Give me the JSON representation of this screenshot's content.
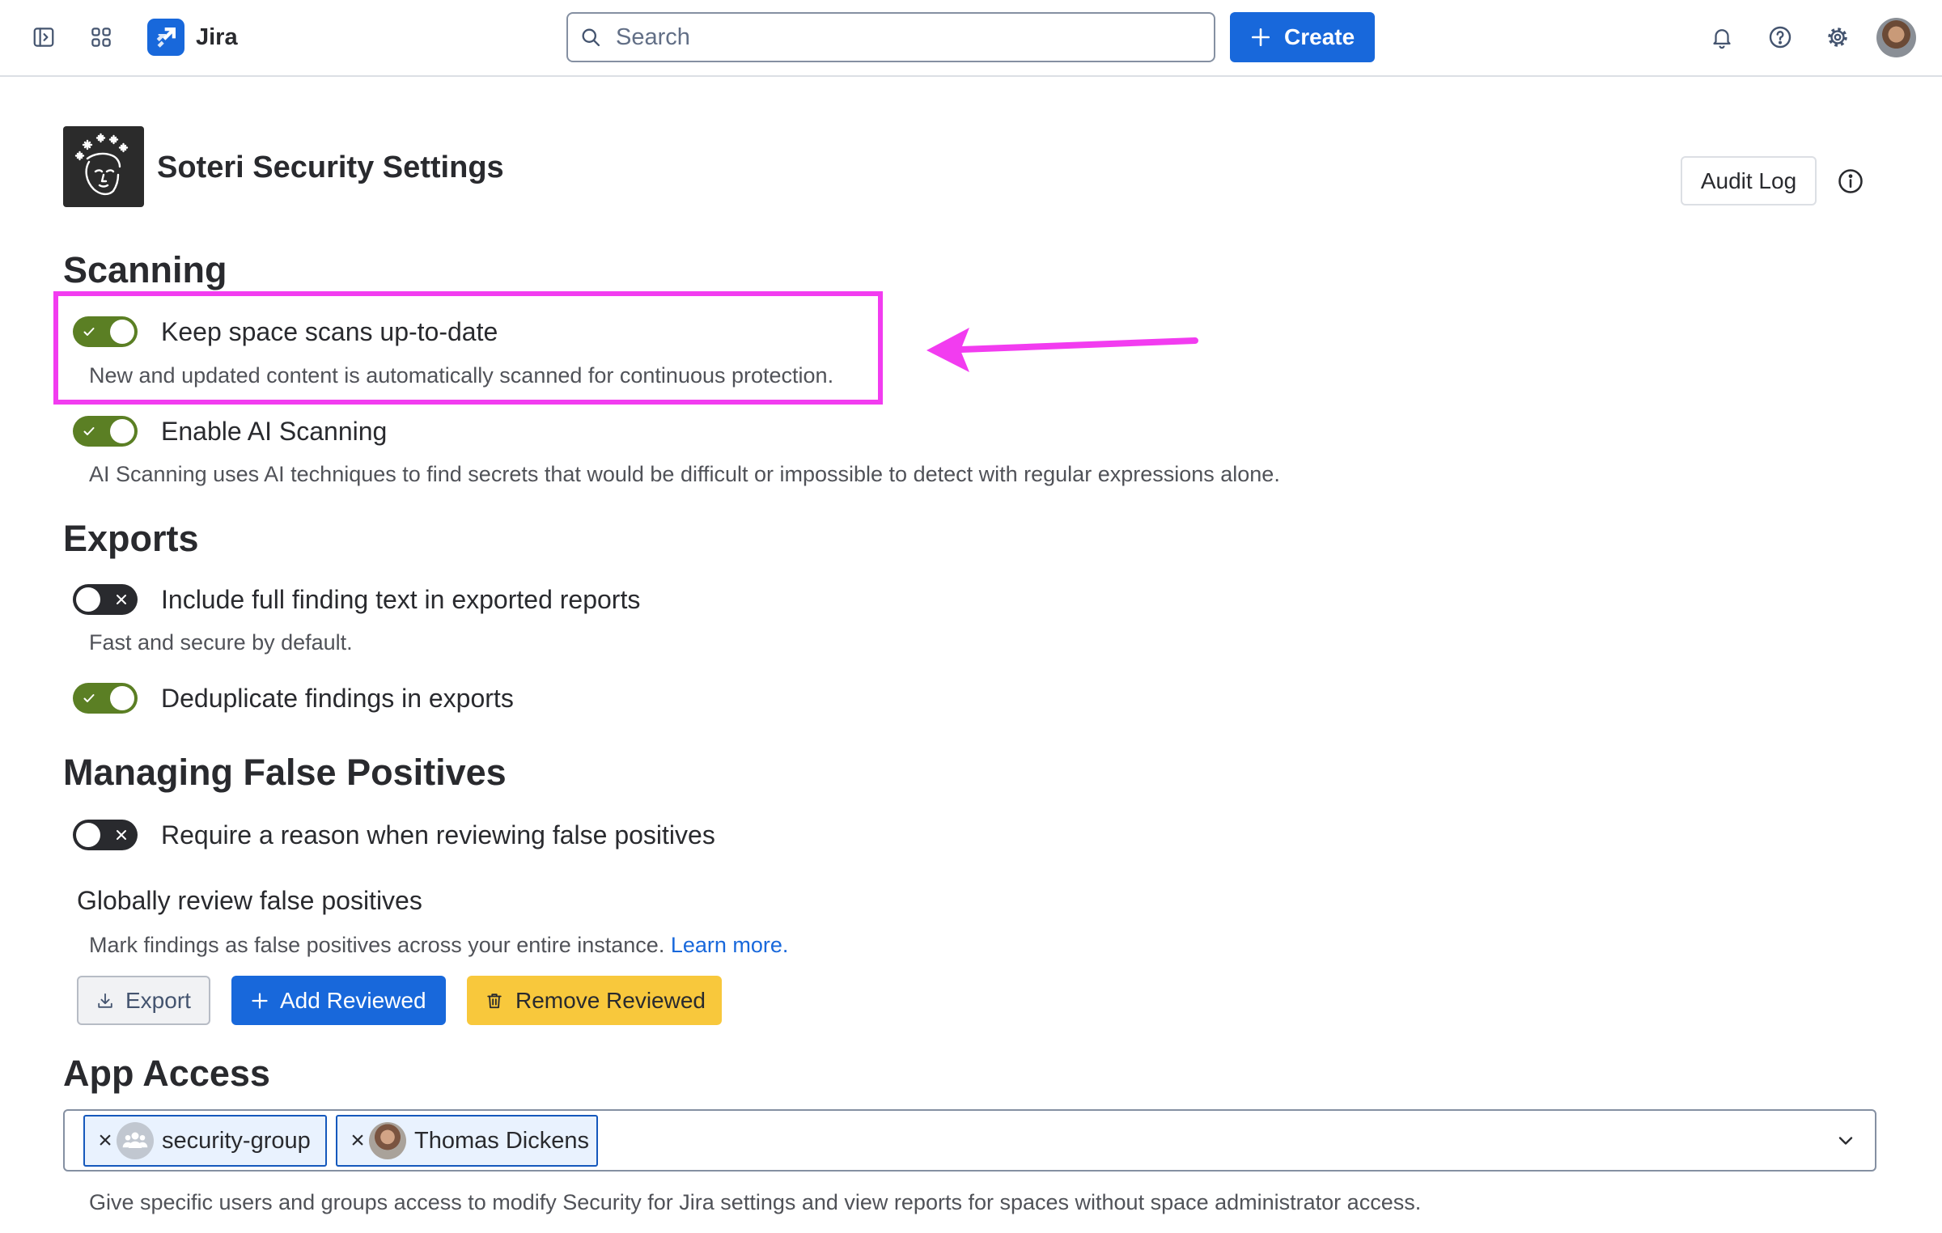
{
  "topbar": {
    "app_name": "Jira",
    "search": {
      "placeholder": "Search",
      "value": ""
    },
    "create_label": "Create",
    "icons": {
      "sidebar_toggle": "sidebar-toggle-icon",
      "app_switcher": "app-switcher-icon",
      "notifications": "bell-icon",
      "help": "help-icon",
      "settings": "gear-icon"
    }
  },
  "page": {
    "title": "Soteri Security Settings",
    "audit_log_label": "Audit Log",
    "info_icon": "info-icon"
  },
  "scanning": {
    "heading": "Scanning",
    "settings": [
      {
        "label": "Keep space scans up-to-date",
        "description": "New and updated content is automatically scanned for continuous protection.",
        "enabled": true
      },
      {
        "label": "Enable AI Scanning",
        "description": "AI Scanning uses AI techniques to find secrets that would be difficult or impossible to detect with regular expressions alone.",
        "enabled": true
      }
    ]
  },
  "exports": {
    "heading": "Exports",
    "settings": [
      {
        "label": "Include full finding text in exported reports",
        "description": "Fast and secure by default.",
        "enabled": false
      },
      {
        "label": "Deduplicate findings in exports",
        "enabled": true
      }
    ]
  },
  "false_positives": {
    "heading": "Managing False Positives",
    "settings": [
      {
        "label": "Require a reason when reviewing false positives",
        "enabled": false
      }
    ],
    "global_review": {
      "title": "Globally review false positives",
      "description": "Mark findings as false positives across your entire instance.",
      "learn_more": "Learn more.",
      "buttons": {
        "export": "Export",
        "add": "Add Reviewed",
        "remove": "Remove Reviewed"
      }
    }
  },
  "app_access": {
    "heading": "App Access",
    "remove_glyph": "×",
    "selected": [
      {
        "label": "security-group",
        "icon": "group-icon"
      },
      {
        "label": "Thomas Dickens",
        "icon": "user-avatar"
      }
    ],
    "description": "Give specific users and groups access to modify Security for Jira settings and view reports for spaces without space administrator access."
  },
  "colors": {
    "toggle_on": "#5B7F24",
    "toggle_off": "#292A2E",
    "primary": "#1868DB",
    "warning": "#F8C83C",
    "annotation": "#F23CF0"
  }
}
